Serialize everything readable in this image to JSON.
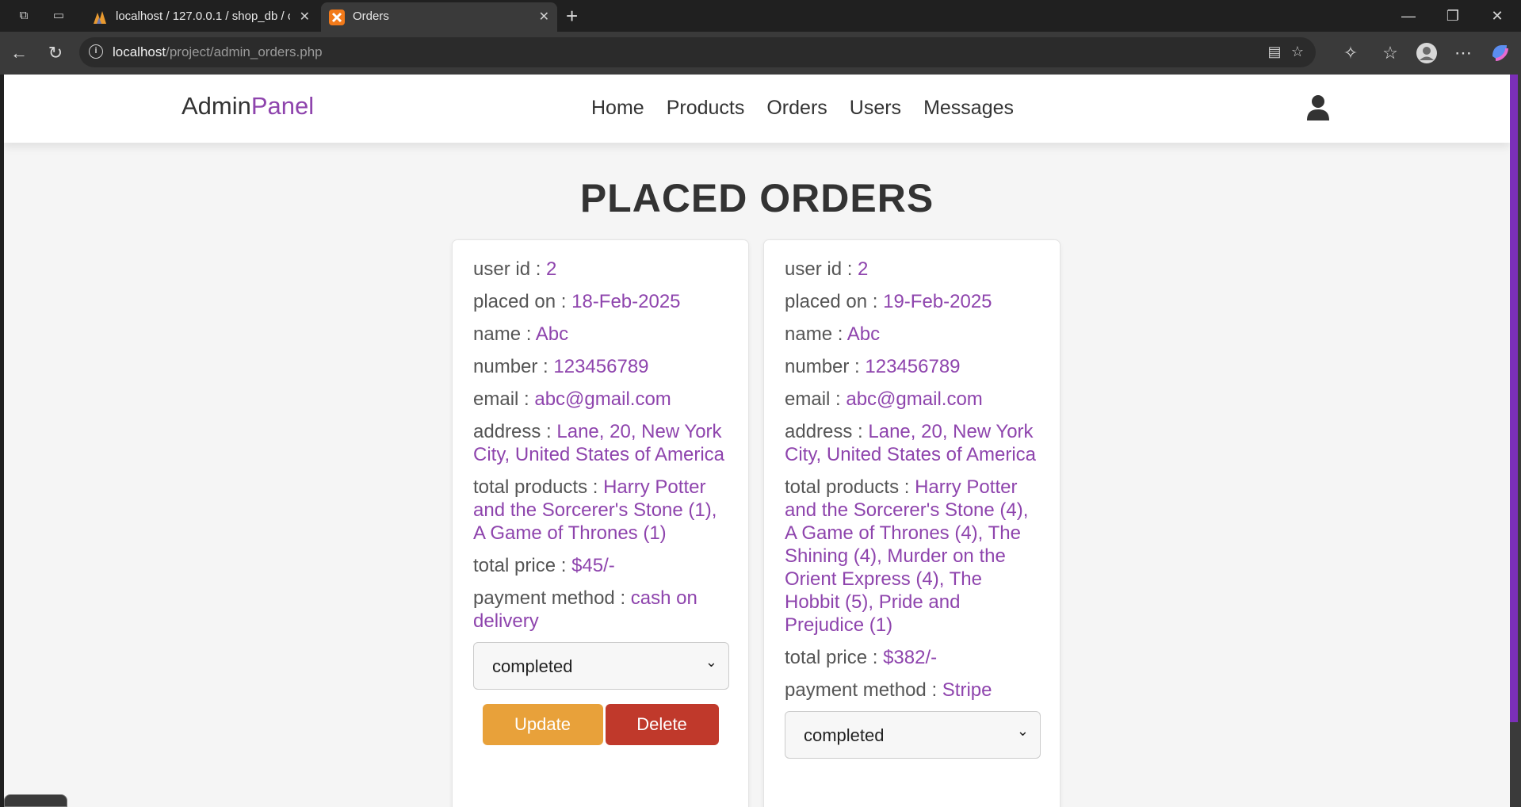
{
  "browser": {
    "tabs": [
      {
        "title": "localhost / 127.0.0.1 / shop_db / o",
        "active": false,
        "favicon": "phpmyadmin-icon"
      },
      {
        "title": "Orders",
        "active": true,
        "favicon": "xampp-icon"
      }
    ],
    "url_host": "localhost",
    "url_path": "/project/admin_orders.php"
  },
  "header": {
    "logo_main": "Admin",
    "logo_accent": "Panel",
    "nav": [
      "Home",
      "Products",
      "Orders",
      "Users",
      "Messages"
    ]
  },
  "page": {
    "title": "PLACED ORDERS"
  },
  "labels": {
    "user_id": "user id : ",
    "placed_on": "placed on : ",
    "name": "name : ",
    "number": "number : ",
    "email": "email : ",
    "address": "address : ",
    "total_products": "total products : ",
    "total_price": "total price : ",
    "payment_method": "payment method : ",
    "update": "Update",
    "delete": "Delete"
  },
  "orders": [
    {
      "user_id": "2",
      "placed_on": "18-Feb-2025",
      "name": "Abc",
      "number": "123456789",
      "email": "abc@gmail.com",
      "address": "Lane, 20, New York City, United States of America",
      "total_products": "Harry Potter and the Sorcerer's Stone (1), A Game of Thrones (1)",
      "total_price": "$45/-",
      "payment_method": "cash on delivery",
      "status": "completed"
    },
    {
      "user_id": "2",
      "placed_on": "19-Feb-2025",
      "name": "Abc",
      "number": "123456789",
      "email": "abc@gmail.com",
      "address": "Lane, 20, New York City, United States of America",
      "total_products": "Harry Potter and the Sorcerer's Stone (4), A Game of Thrones (4), The Shining (4), Murder on the Orient Express (4), The Hobbit (5), Pride and Prejudice (1)",
      "total_price": "$382/-",
      "payment_method": "Stripe",
      "status": "completed"
    }
  ],
  "colors": {
    "accent": "#8e44ad",
    "update_button": "#e8a13a",
    "delete_button": "#c0392b"
  }
}
